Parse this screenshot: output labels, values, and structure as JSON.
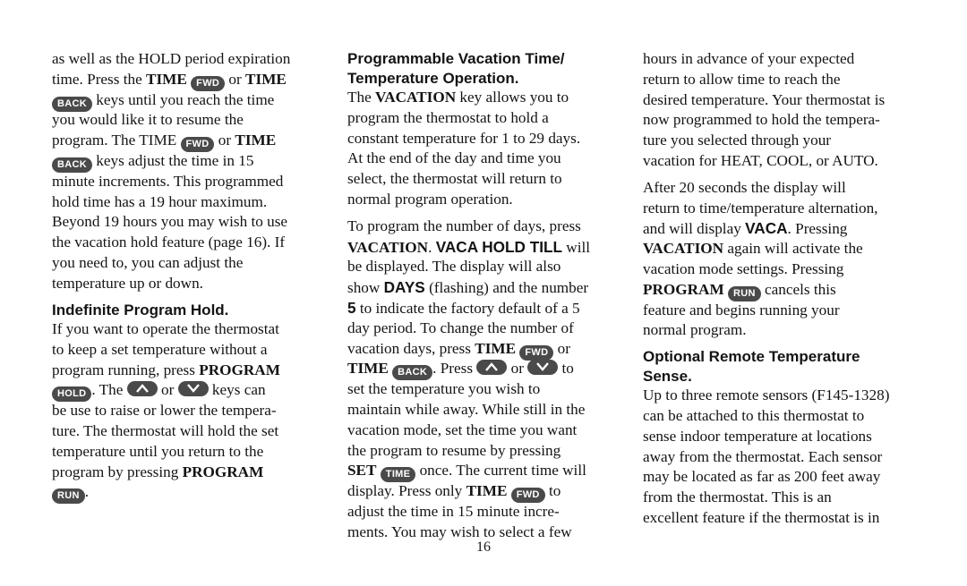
{
  "page_number": "16",
  "keys": {
    "fwd": "FWD",
    "back": "BACK",
    "hold": "HOLD",
    "run": "RUN",
    "time": "TIME"
  },
  "col1": {
    "l1": "as well as the HOLD period expiration",
    "l2a": "time. Press the ",
    "l2b": "TIME",
    "l2c": " or ",
    "l2d": "TIME",
    "l3": " keys until you reach the time",
    "l4": "you would like it to resume the",
    "l5a": "program. The TIME ",
    "l5b": " or ",
    "l5c": "TIME",
    "l6": " keys adjust the time in 15",
    "l7": "minute increments. This programmed",
    "l8": "hold time has a 19 hour maximum.",
    "l9": "Beyond 19 hours you may wish to use",
    "l10": "the vacation hold feature (page 16). If",
    "l11": "you need to, you can adjust the",
    "l12": "temperature up or down.",
    "heading": "Indefinite Program Hold.",
    "m1": "If you want to operate the thermostat",
    "m2": "to keep a set temperature without a",
    "m3a": "program running, press ",
    "m3b": "PROGRAM",
    "m4a": ". The ",
    "m4b": " or ",
    "m4c": " keys can",
    "m5": "be use to raise or lower the tempera-",
    "m6": "ture. The thermostat will hold the set",
    "m7": "temperature until you return to the",
    "m8a": "program by pressing  ",
    "m8b": "PROGRAM",
    "m9": "."
  },
  "col2": {
    "heading1": "Programmable Vacation Time/",
    "heading2": "Temperature Operation.",
    "p1a": "The ",
    "p1b": "VACATION",
    "p1c": " key allows you to",
    "p2": "program the thermostat to hold a",
    "p3": "constant temperature for 1 to 29 days.",
    "p4": "At the end of the day and time you",
    "p5": "select, the thermostat will return to",
    "p6": "normal program operation.",
    "q1": "To program the number of days, press",
    "q2a": "VACATION",
    "q2b": ". ",
    "q2c": "VACA HOLD TILL",
    "q2d": " will",
    "q3": "be displayed. The display will also",
    "q4a": "show ",
    "q4b": "DAYS",
    "q4c": " (flashing) and the number",
    "q5a": "5",
    "q5b": " to indicate the factory default of a 5",
    "q6": "day period. To change the number of",
    "q7a": "vacation days, press ",
    "q7b": "TIME",
    "q7c": " or",
    "q8a": "TIME",
    "q8b": ". Press ",
    "q8c": " or ",
    "q8d": " to",
    "q9": "set the temperature you wish to",
    "q10": "maintain while away. While still in the",
    "q11": "vacation mode, set the time you want",
    "q12": "the program to resume by pressing",
    "q13a": "SET",
    "q13b": " once. The current time will",
    "q14a": "display. Press only ",
    "q14b": "TIME",
    "q14c": " to",
    "q15": "adjust the time in 15 minute incre-",
    "q16": "ments. You may wish to select a few"
  },
  "col3": {
    "p1": "hours in advance of your expected",
    "p2": "return to allow time to reach the",
    "p3": "desired temperature. Your thermostat is",
    "p4": "now programmed to hold the tempera-",
    "p5": "ture you selected through your",
    "p6": "vacation for HEAT, COOL, or AUTO.",
    "q1": "After 20 seconds the display will",
    "q2": "return to time/temperature alternation,",
    "q3a": "and will display ",
    "q3b": "VACA",
    "q3c": ". Pressing",
    "q4a": "VACATION",
    "q4b": " again will activate the",
    "q5": "vacation mode settings. Pressing",
    "q6a": "PROGRAM",
    "q6b": " cancels this",
    "q7": "feature and begins running your",
    "q8": "normal program.",
    "heading1": "Optional Remote Temperature",
    "heading2": "Sense.",
    "r1": "Up to three remote sensors (F145-1328)",
    "r2": "can be attached to this thermostat to",
    "r3": "sense indoor temperature at locations",
    "r4": "away from the thermostat. Each sensor",
    "r5": "may be located as far as 200 feet away",
    "r6": "from the thermostat. This is an",
    "r7": "excellent feature if the thermostat is in"
  }
}
